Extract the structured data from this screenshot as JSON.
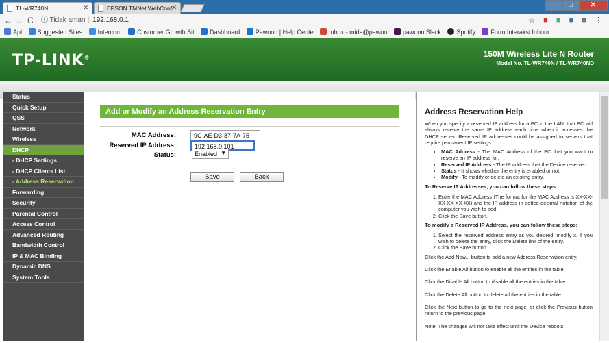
{
  "browser": {
    "tabs": [
      {
        "title": "TL-WR740N"
      },
      {
        "title": "EPSON TMNet WebConfi"
      }
    ],
    "address": {
      "secure_label": "Tidak aman",
      "url": "192.168.0.1"
    },
    "bookmarks": [
      {
        "label": "Apl",
        "color": "#4a7bd1"
      },
      {
        "label": "Suggested Sites",
        "color": "#3f7fd6"
      },
      {
        "label": "Intercom",
        "color": "#3c8fd8"
      },
      {
        "label": "Customer Growth Sit",
        "color": "#1f74c8"
      },
      {
        "label": "Dashboard",
        "color": "#1f74c8"
      },
      {
        "label": "Pawoon | Help Cente",
        "color": "#1f74c8"
      },
      {
        "label": "Inbox - mida@pawoo",
        "color": "#d44638"
      },
      {
        "label": "pawoon Slack",
        "color": "#4a154b"
      },
      {
        "label": "Spotify",
        "color": "#222222"
      },
      {
        "label": "Form Interaksi Inbour",
        "color": "#7b3fc4"
      }
    ]
  },
  "router": {
    "logo": "TP-LINK",
    "product_title": "150M Wireless Lite N Router",
    "model_no": "Model No. TL-WR740N / TL-WR740ND"
  },
  "sidebar": {
    "items": [
      {
        "label": "Status",
        "type": "main"
      },
      {
        "label": "Quick Setup",
        "type": "main"
      },
      {
        "label": "QSS",
        "type": "main"
      },
      {
        "label": "Network",
        "type": "main"
      },
      {
        "label": "Wireless",
        "type": "main"
      },
      {
        "label": "DHCP",
        "type": "active"
      },
      {
        "label": "- DHCP Settings",
        "type": "sub"
      },
      {
        "label": "- DHCP Clients List",
        "type": "sub"
      },
      {
        "label": "- Address Reservation",
        "type": "current"
      },
      {
        "label": "Forwarding",
        "type": "main"
      },
      {
        "label": "Security",
        "type": "main"
      },
      {
        "label": "Parental Control",
        "type": "main"
      },
      {
        "label": "Access Control",
        "type": "main"
      },
      {
        "label": "Advanced Routing",
        "type": "main"
      },
      {
        "label": "Bandwidth Control",
        "type": "main"
      },
      {
        "label": "IP & MAC Binding",
        "type": "main"
      },
      {
        "label": "Dynamic DNS",
        "type": "main"
      },
      {
        "label": "System Tools",
        "type": "main"
      }
    ]
  },
  "form": {
    "title": "Add or Modify an Address Reservation Entry",
    "mac_label": "MAC Address:",
    "mac_value": "9C-AE-D3-87-7A-75",
    "ip_label": "Reserved IP Address:",
    "ip_value": "192.168.0.101",
    "status_label": "Status:",
    "status_value": "Enabled",
    "save_label": "Save",
    "back_label": "Back"
  },
  "help": {
    "title": "Address Reservation Help",
    "intro": "When you specify a reserved IP address for a PC in the LAN, that PC will always receive the same IP address each time when it accesses the DHCP server. Reserved IP addresses could be assigned to servers that require permanent IP settings.",
    "defs": [
      {
        "term": "MAC Address",
        "text": " - The MAC Address of the PC that you want to reserve an IP address for."
      },
      {
        "term": "Reserved IP Address",
        "text": " - The IP address that the Device reserved."
      },
      {
        "term": "Status",
        "text": " - It shows whether the entry is enabled or not."
      },
      {
        "term": "Modify",
        "text": " - To modify or delete an existing entry."
      }
    ],
    "reserve_heading": "To Reserve IP Addresses, you can follow these steps:",
    "reserve_steps": [
      "Enter the MAC Address (The format for the MAC Address is XX-XX-XX-XX-XX-XX) and the IP address in dotted-decimal notation of the computer you wish to add.",
      "Click the Save button."
    ],
    "modify_heading": "To modify a Reserved IP Address, you can follow these steps:",
    "modify_steps": [
      "Select the reserved address entry as you desired, modify it. If you wish to delete the entry, click the Delete link of the entry.",
      "Click the Save button."
    ],
    "p_add": "Click the Add New... button to add a new Address Reservation entry.",
    "p_enable": "Click the Enable All button to enable all the entries in the table.",
    "p_disable": "Click the Disable All button to disable all the entries in the table.",
    "p_delete": "Click the Delete All button to delete all the entries in the table.",
    "p_next": "Click the Next button to go to the next page, or click the Previous button return to the previous page.",
    "p_note": "Note: The changes will not take effect until the Device reboots."
  }
}
